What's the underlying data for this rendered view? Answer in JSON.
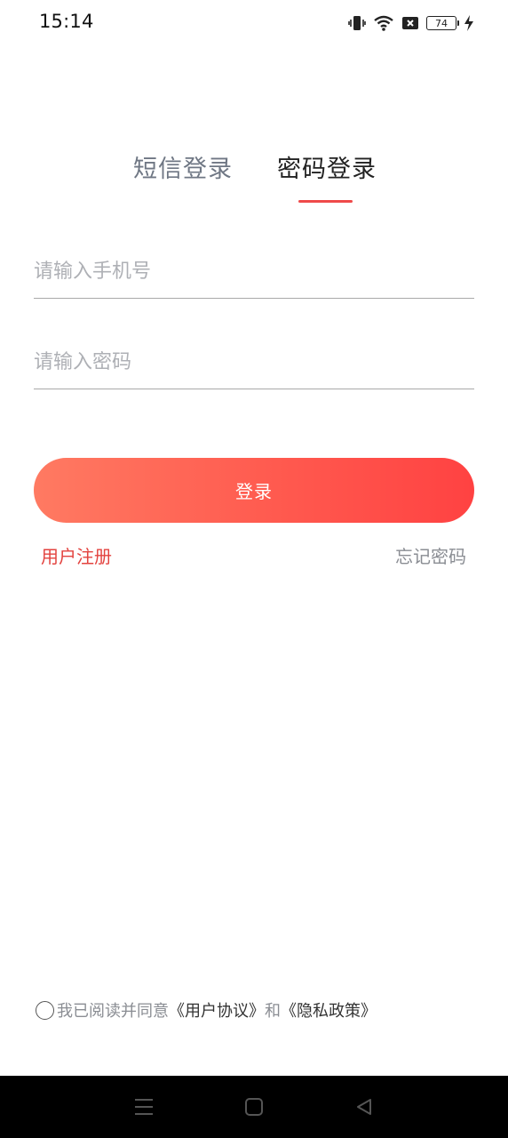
{
  "status_bar": {
    "time": "15:14",
    "battery_level": "74",
    "icons": [
      "vibrate-icon",
      "wifi-icon",
      "sim-blocked-icon",
      "battery-icon",
      "charging-icon"
    ]
  },
  "tabs": [
    {
      "label": "短信登录",
      "active": false
    },
    {
      "label": "密码登录",
      "active": true
    }
  ],
  "form": {
    "phone_placeholder": "请输入手机号",
    "password_placeholder": "请输入密码",
    "phone_value": "",
    "password_value": ""
  },
  "login_button_label": "登录",
  "links": {
    "register": "用户注册",
    "forgot_password": "忘记密码"
  },
  "agreement": {
    "prefix": "我已阅读并同意",
    "user_agreement": "《用户协议》",
    "conjunction": "和",
    "privacy_policy": "《隐私政策》",
    "checked": false
  },
  "nav_bar": {
    "icons": [
      "menu-icon",
      "home-icon",
      "back-icon"
    ]
  },
  "colors": {
    "accent": "#ef4a4a",
    "button_gradient_start": "#ff7a62",
    "button_gradient_end": "#ff4242",
    "inactive_tab": "#6f7784"
  }
}
